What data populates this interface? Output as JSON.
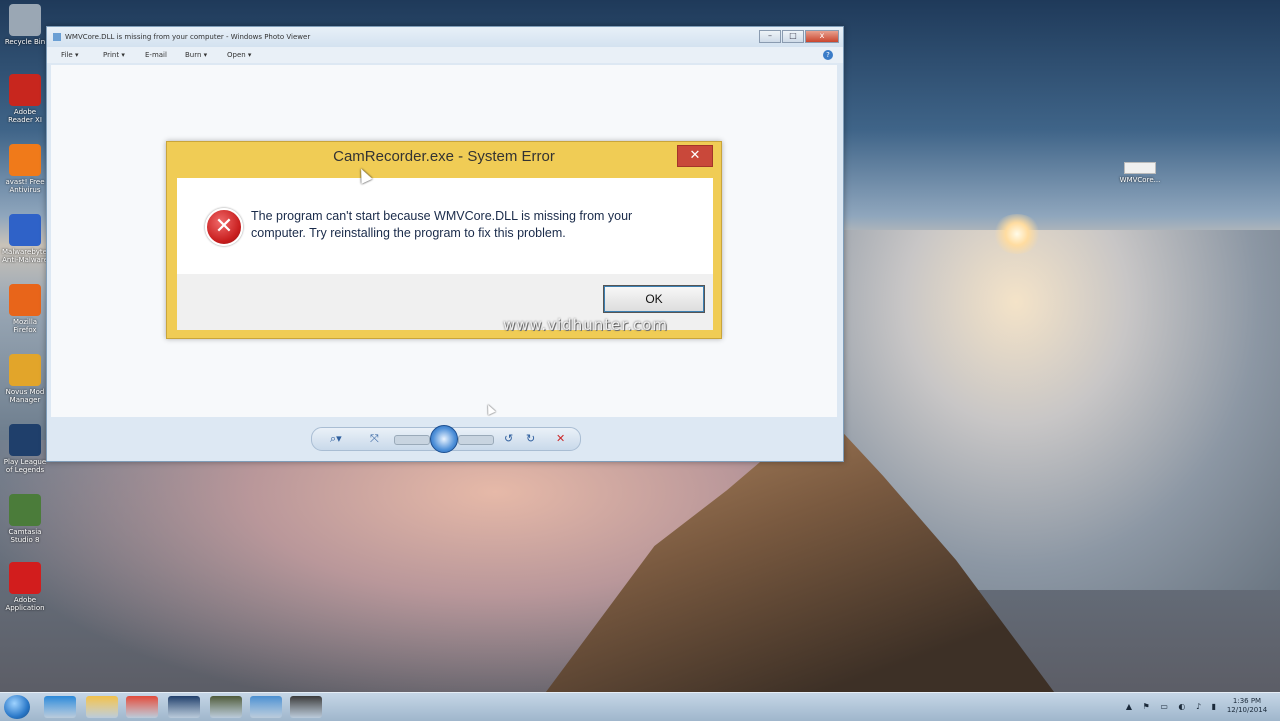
{
  "desktop": {
    "icons": [
      {
        "label": "Recycle Bin",
        "color": "#9aa7b4"
      },
      {
        "label": "Adobe Reader XI",
        "color": "#c8261e"
      },
      {
        "label": "avast! Free Antivirus",
        "color": "#f07a1a"
      },
      {
        "label": "Malwarebytes Anti-Malware",
        "color": "#2f62c8"
      },
      {
        "label": "Mozilla Firefox",
        "color": "#e8651a"
      },
      {
        "label": "Novus Mod Manager",
        "color": "#e2a52a"
      },
      {
        "label": "Play League of Legends",
        "color": "#1f3f6b"
      },
      {
        "label": "Camtasia Studio 8",
        "color": "#4b7c3a"
      },
      {
        "label": "Adobe Application",
        "color": "#d21d1d"
      }
    ],
    "file_icon": {
      "label": "WMVCore..."
    }
  },
  "viewer": {
    "title": "WMVCore.DLL is missing from your computer - Windows Photo Viewer",
    "menu": [
      "File ▾",
      "Print ▾",
      "E-mail",
      "Burn ▾",
      "Open ▾"
    ],
    "help_glyph": "?",
    "window_buttons": {
      "minimize": "–",
      "maximize": "□",
      "close": "x"
    },
    "controls": {
      "zoom": "⌕▾",
      "fit": "⤧",
      "prev": "◂◂",
      "next": "▸▸",
      "rotate_ccw": "↺",
      "rotate_cw": "↻",
      "delete": "✕"
    }
  },
  "dialog": {
    "title": "CamRecorder.exe - System Error",
    "close_glyph": "✕",
    "error_glyph": "✕",
    "message_line1": "The program can't start because WMVCore.DLL is missing from your",
    "message_line2": "computer. Try reinstalling the program to fix this problem.",
    "ok_label": "OK",
    "watermark": "www.vidhunter.com"
  },
  "taskbar": {
    "apps": [
      {
        "name": "internet-explorer",
        "color": "#2a88d8"
      },
      {
        "name": "file-explorer",
        "color": "#f0c04a"
      },
      {
        "name": "chrome",
        "color": "#e04a3a"
      },
      {
        "name": "league-of-legends",
        "color": "#1f3f6b"
      },
      {
        "name": "app-5",
        "color": "#4e5a3a"
      },
      {
        "name": "app-6",
        "color": "#4a8fd0"
      },
      {
        "name": "app-7",
        "color": "#3a3a3a"
      }
    ],
    "tray_glyphs": "▲ ⚑ ▭ ◐ ♪ ▮",
    "clock_time": "1:36 PM",
    "clock_date": "12/10/2014"
  }
}
